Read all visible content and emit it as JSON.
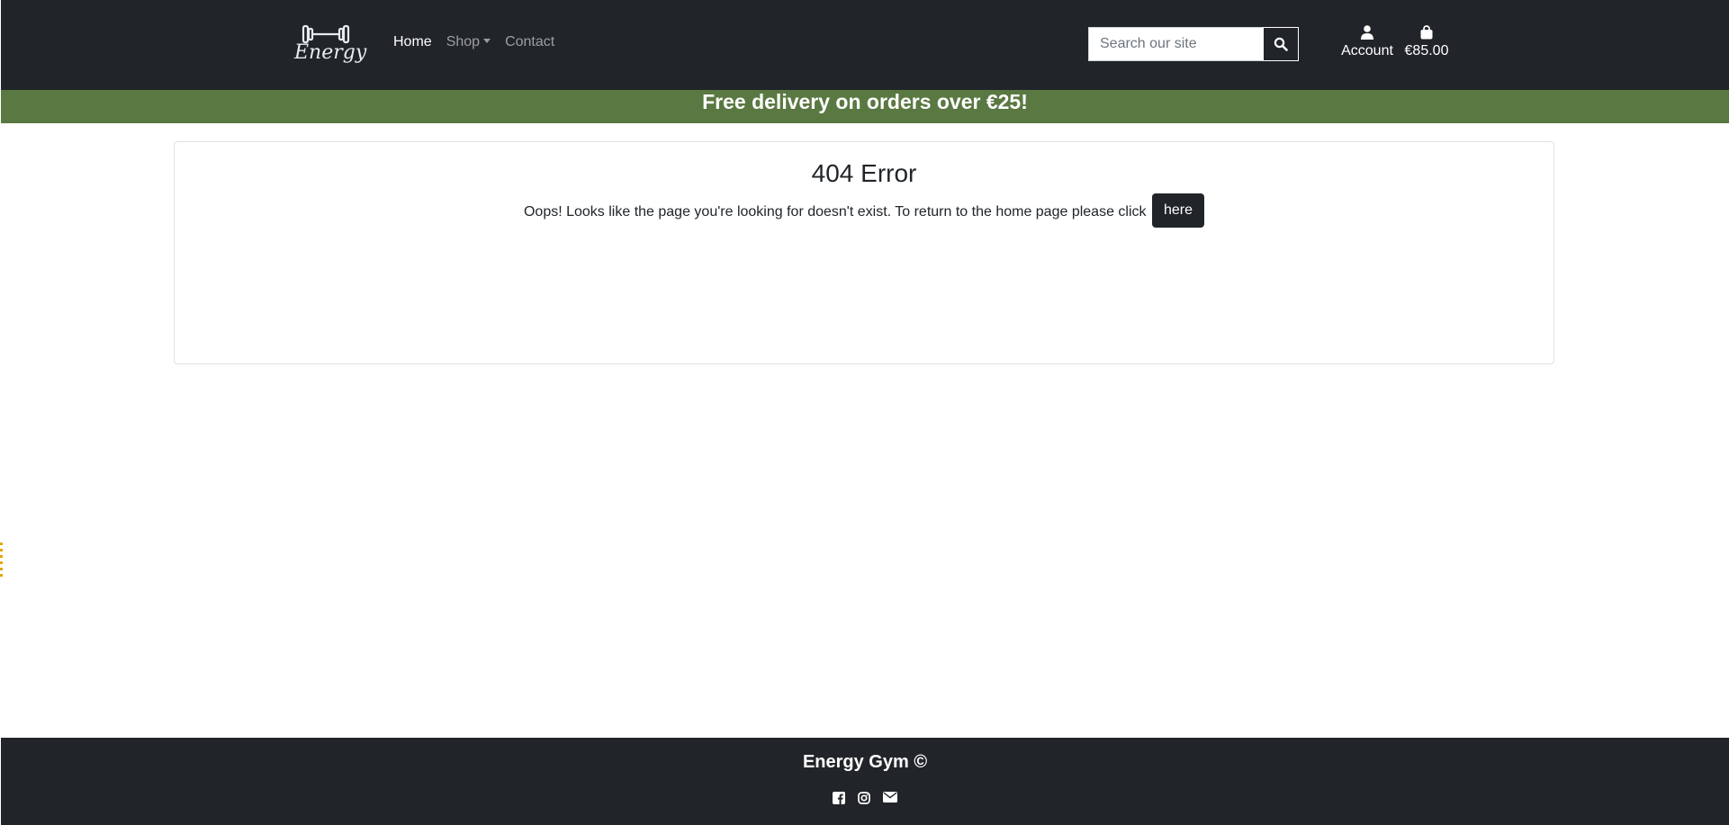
{
  "brand": {
    "logo_text": "Energy"
  },
  "nav": {
    "home": "Home",
    "shop": "Shop",
    "contact": "Contact"
  },
  "search": {
    "placeholder": "Search our site",
    "icon": "search-icon"
  },
  "account": {
    "label": "Account",
    "icon": "user-icon"
  },
  "bag": {
    "total": "€85.00",
    "icon": "shopping-bag-icon"
  },
  "banner": {
    "text": "Free delivery on orders over €25!"
  },
  "error": {
    "title": "404 Error",
    "message": "Oops! Looks like the page you're looking for doesn't exist. To return to the home page please click",
    "button_label": "here"
  },
  "footer": {
    "title": "Energy Gym ©",
    "social_icons": [
      "facebook-icon",
      "instagram-icon",
      "email-icon"
    ]
  },
  "colors": {
    "navbar": "#212529",
    "banner": "#5a7842",
    "text": "#212529",
    "white": "#ffffff"
  }
}
